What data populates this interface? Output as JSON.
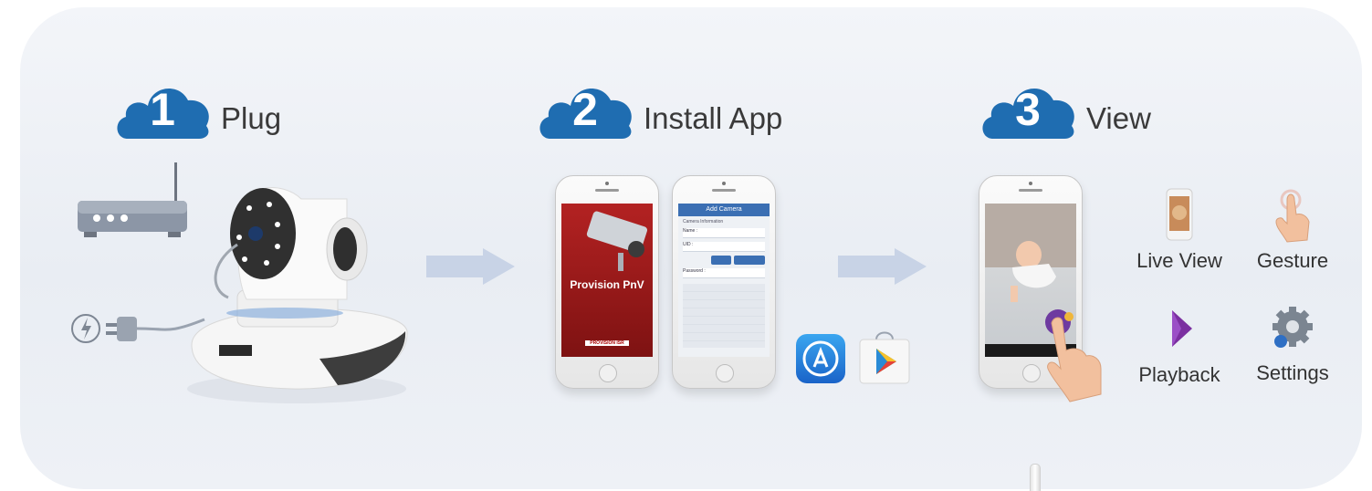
{
  "steps": [
    {
      "number": "1",
      "label": "Plug"
    },
    {
      "number": "2",
      "label": "Install App"
    },
    {
      "number": "3",
      "label": "View"
    }
  ],
  "features": [
    {
      "label": "Live View",
      "icon": "live-view-icon"
    },
    {
      "label": "Gesture",
      "icon": "gesture-icon"
    },
    {
      "label": "Playback",
      "icon": "playback-icon"
    },
    {
      "label": "Settings",
      "icon": "settings-icon"
    }
  ],
  "app_screen": {
    "splash_title": "Provision PnV",
    "brand": "PROVISION ISR",
    "add_camera_title": "Add Camera",
    "camera_info": "Camera Information",
    "name_label": "Name :",
    "uid_label": "UID :",
    "password_label": "Password :"
  },
  "colors": {
    "cloud": "#1f6db1",
    "arrow": "#c8d3e6",
    "text": "#3a3a3a"
  }
}
